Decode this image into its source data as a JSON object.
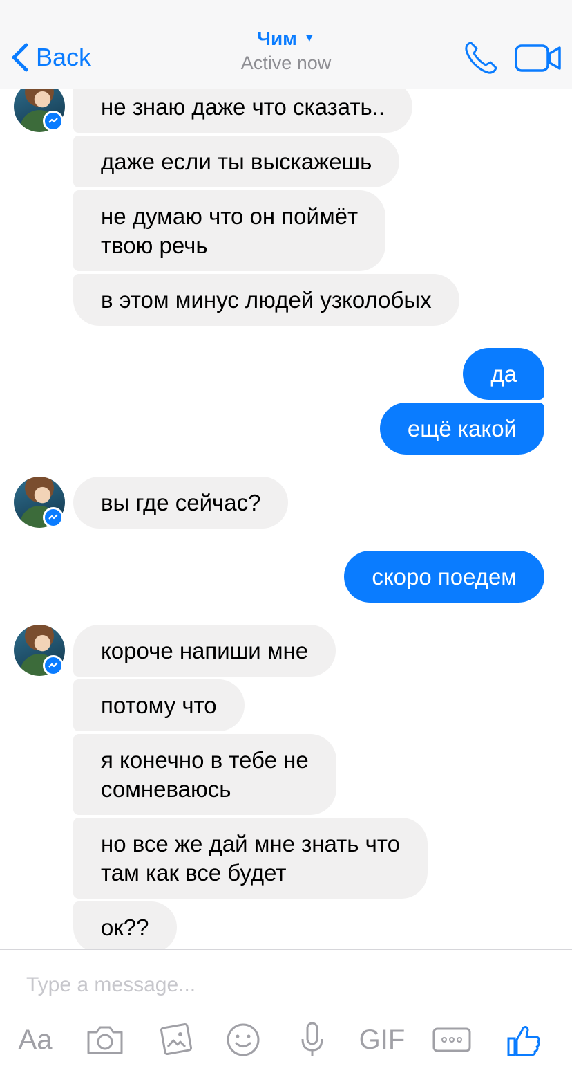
{
  "header": {
    "back_label": "Back",
    "contact_name": "Чим",
    "status": "Active now"
  },
  "colors": {
    "accent": "#0a7cff",
    "incoming_bubble": "#f1f0f0",
    "outgoing_bubble": "#0a7cff"
  },
  "messages": [
    {
      "side": "in",
      "text": "не знаю даже что сказать.."
    },
    {
      "side": "in",
      "text": "даже если ты выскажешь"
    },
    {
      "side": "in",
      "line1": "не думаю что он поймёт",
      "line2": "твою речь"
    },
    {
      "side": "in",
      "text": "в этом минус людей узколобых"
    },
    {
      "side": "out",
      "text": "да"
    },
    {
      "side": "out",
      "text": "ещё какой"
    },
    {
      "side": "in",
      "text": "вы где сейчас?"
    },
    {
      "side": "out",
      "text": "скоро поедем"
    },
    {
      "side": "in",
      "text": "короче напиши мне"
    },
    {
      "side": "in",
      "text": "потому что"
    },
    {
      "side": "in",
      "line1": "я конечно в тебе не",
      "line2": "сомневаюсь"
    },
    {
      "side": "in",
      "line1": "но все же дай мне знать что",
      "line2": "там как все будет"
    },
    {
      "side": "in",
      "text": "ок??"
    }
  ],
  "composer": {
    "placeholder": "Type a message...",
    "text_tool": "Aa",
    "gif_label": "GIF",
    "icons": [
      "camera-icon",
      "photo-gallery-icon",
      "emoji-icon",
      "microphone-icon",
      "more-icon",
      "thumbs-up-icon"
    ]
  }
}
